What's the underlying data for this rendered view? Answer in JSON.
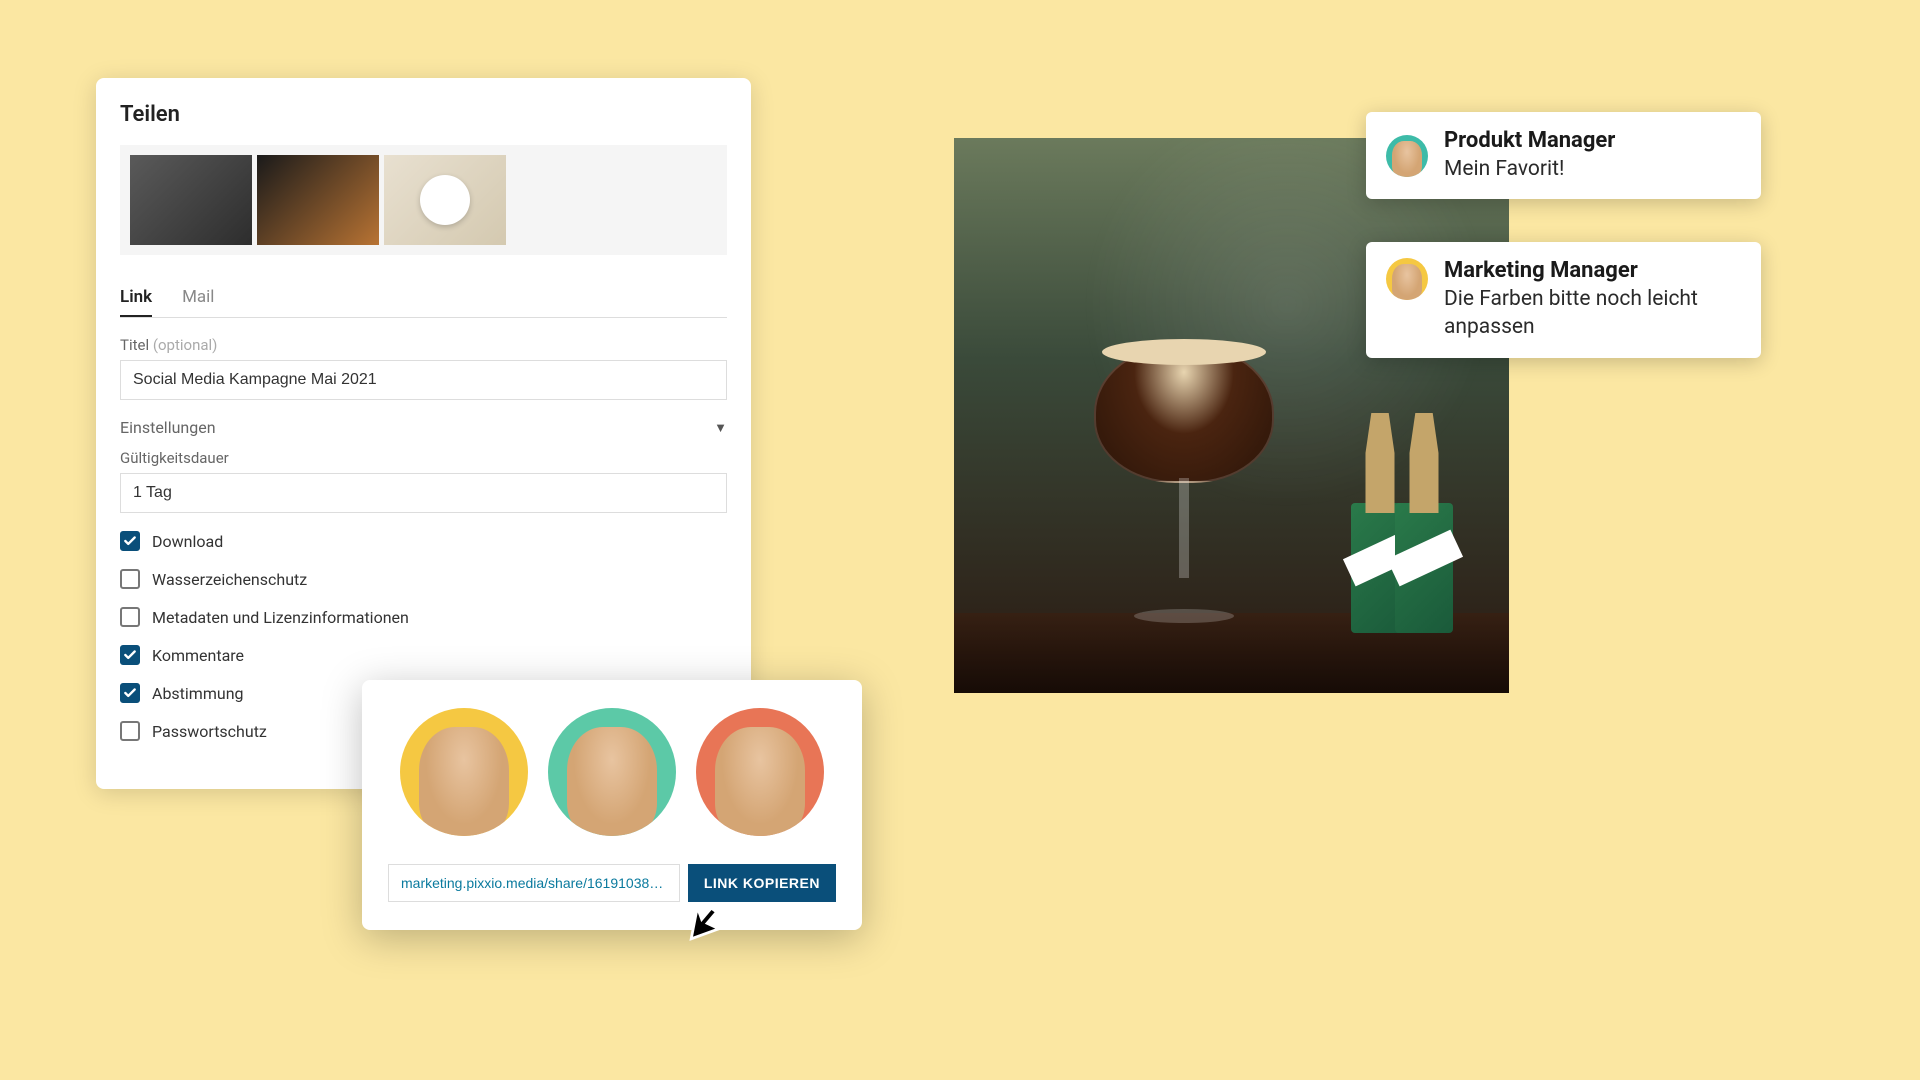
{
  "share": {
    "title": "Teilen",
    "tabs": {
      "link": "Link",
      "mail": "Mail"
    },
    "title_field": {
      "label": "Titel",
      "optional": "(optional)",
      "value": "Social Media Kampagne Mai 2021"
    },
    "settings_label": "Einstellungen",
    "validity": {
      "label": "Gültigkeitsdauer",
      "value": "1 Tag"
    },
    "options": {
      "download": "Download",
      "watermark": "Wasserzeichenschutz",
      "metadata": "Metadaten und Lizenzinformationen",
      "comments": "Kommentare",
      "voting": "Abstimmung",
      "password": "Passwortschutz"
    }
  },
  "link_popup": {
    "url": "marketing.pixxio.media/share/1619103889...",
    "copy_label": "LINK KOPIEREN"
  },
  "comments": [
    {
      "role": "Produkt Manager",
      "text": "Mein Favorit!"
    },
    {
      "role": "Marketing Manager",
      "text": "Die Farben bitte noch leicht anpassen"
    }
  ]
}
